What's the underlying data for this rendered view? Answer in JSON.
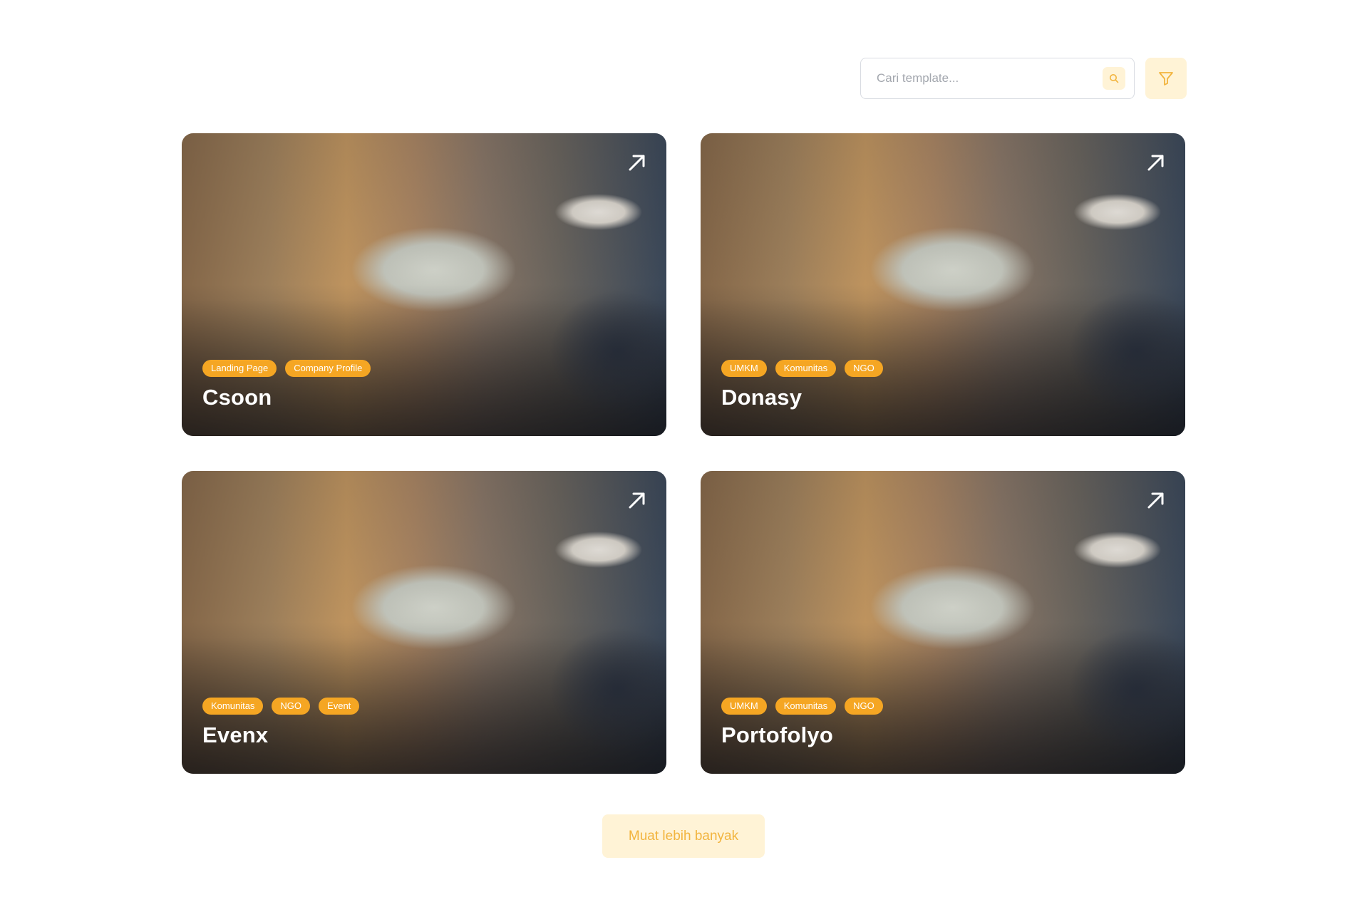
{
  "search": {
    "placeholder": "Cari template..."
  },
  "colors": {
    "accent": "#f5a623",
    "accent_soft": "#fff3d6",
    "tag_text": "#ffffff"
  },
  "icons": {
    "search": "search-icon",
    "filter": "filter-icon",
    "open": "arrow-up-right-icon"
  },
  "cards": [
    {
      "title": "Csoon",
      "tags": [
        "Landing Page",
        "Company Profile"
      ]
    },
    {
      "title": "Donasy",
      "tags": [
        "UMKM",
        "Komunitas",
        "NGO"
      ]
    },
    {
      "title": "Evenx",
      "tags": [
        "Komunitas",
        "NGO",
        "Event"
      ]
    },
    {
      "title": "Portofolyo",
      "tags": [
        "UMKM",
        "Komunitas",
        "NGO"
      ]
    }
  ],
  "load_more": {
    "label": "Muat lebih banyak"
  }
}
